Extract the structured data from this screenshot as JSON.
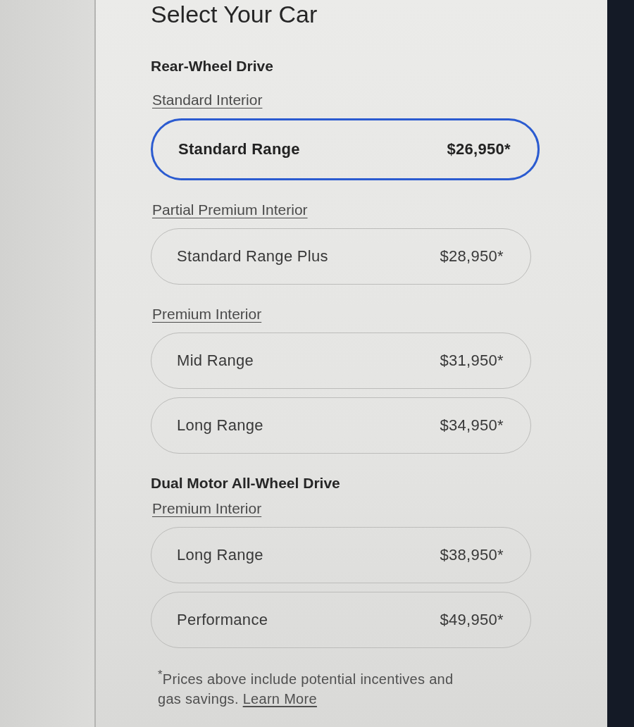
{
  "title": "Select Your Car",
  "drive_groups": [
    {
      "heading": "Rear-Wheel Drive",
      "interiors": [
        {
          "label": "Standard Interior",
          "options": [
            {
              "name": "Standard Range",
              "price": "$26,950*",
              "selected": true
            }
          ]
        },
        {
          "label": "Partial Premium Interior",
          "options": [
            {
              "name": "Standard Range Plus",
              "price": "$28,950*",
              "selected": false
            }
          ]
        },
        {
          "label": "Premium Interior",
          "options": [
            {
              "name": "Mid Range",
              "price": "$31,950*",
              "selected": false
            },
            {
              "name": "Long Range",
              "price": "$34,950*",
              "selected": false
            }
          ]
        }
      ]
    },
    {
      "heading": "Dual Motor All-Wheel Drive",
      "interiors": [
        {
          "label": "Premium Interior",
          "options": [
            {
              "name": "Long Range",
              "price": "$38,950*",
              "selected": false
            },
            {
              "name": "Performance",
              "price": "$49,950*",
              "selected": false
            }
          ]
        }
      ]
    }
  ],
  "footnote": {
    "text": "$^{*}$Prices above include potential incentives and gas savings.",
    "link": "Learn More"
  }
}
